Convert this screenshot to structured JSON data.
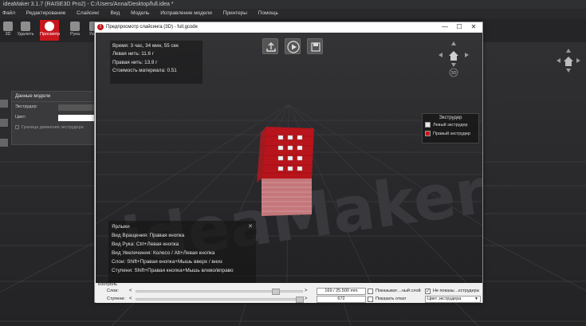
{
  "main_window": {
    "title": "ideaMaker 3.1.7 (RAISE3D Pro2) - C:/Users/Anna/Desktop/full.idea *",
    "menu": [
      "Файл",
      "Редактирование",
      "Слайсинг",
      "Вид",
      "Модель",
      "Исправление модели",
      "Принтеры",
      "Помощь"
    ],
    "toolbar": [
      "3D",
      "Удалить",
      "Просмотр",
      "Рука",
      "Увел"
    ],
    "model_panel": {
      "title": "Данные модели",
      "extruder_label": "Экструдер:",
      "color_label": "Цвет:",
      "boundary_label": "Граница движения экструдера"
    },
    "watermark": "IdeaMaker"
  },
  "dialog": {
    "title": "Предпросмотр слайсинга (3D) - full.gcode",
    "stats": [
      "Время: 3 час, 34 мин, 55 сек",
      "Левая нить: 11.6 г",
      "Правая нить: 13.9 г",
      "Стоимость материала: 0.51"
    ],
    "legend": {
      "title": "Экструдер",
      "items": [
        {
          "label": "Левый экструдер",
          "color": "#e8e8e8"
        },
        {
          "label": "Правый экструдер",
          "color": "#c8161d"
        }
      ]
    },
    "shortcuts": {
      "title": "Ярлыки",
      "close": "✕",
      "lines": [
        "Вид Вращения: Правая кнопка",
        "Вид Рука: Ctrl+Левая кнопка",
        "Вид Увеличения: Колесо / Alt+Левая кнопка",
        "Слои: Shift+Правая кнопка+Мышь вверх / вниз",
        "Ступени: Shift+Правая кнопка+Мышь влево/вправо"
      ]
    },
    "nav_label": "3D",
    "control": {
      "label": "Контроль",
      "layers_label": "Слои:",
      "layers_value": "169 / 25.500 mm",
      "layers_level": 0.85,
      "steps_label": "Ступени:",
      "steps_value": "672",
      "steps_level": 1.0,
      "show_single_layer": "Показыват…ный слой",
      "hide_extruder": "Не показы…кструдера",
      "show_retract": "Показать откат",
      "color_mode": "Цвет экструдера"
    }
  }
}
